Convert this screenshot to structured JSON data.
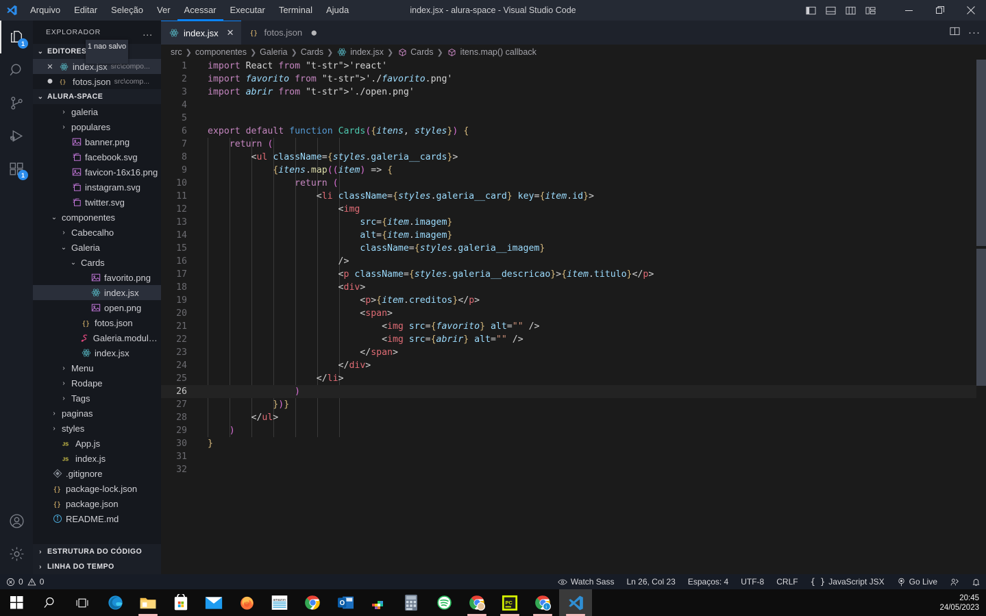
{
  "titlebar": {
    "menus": [
      "Arquivo",
      "Editar",
      "Seleção",
      "Ver",
      "Acessar",
      "Executar",
      "Terminal",
      "Ajuda"
    ],
    "active_menu": "Acessar",
    "window_title": "index.jsx - alura-space - Visual Studio Code",
    "layout_icons": [
      "toggle-primary-sidebar-icon",
      "toggle-panel-icon",
      "toggle-secondary-sidebar-icon",
      "customize-layout-icon"
    ],
    "window_controls": [
      "minimize",
      "restore",
      "close"
    ]
  },
  "activitybar": {
    "items": [
      {
        "name": "explorer-icon",
        "badge": "1",
        "active": true
      },
      {
        "name": "search-icon",
        "badge": "",
        "active": false
      },
      {
        "name": "source-control-icon",
        "badge": "",
        "active": false
      },
      {
        "name": "run-and-debug-icon",
        "badge": "",
        "active": false
      },
      {
        "name": "extensions-icon",
        "badge": "1",
        "active": false
      }
    ],
    "bottom": [
      {
        "name": "accounts-icon"
      },
      {
        "name": "settings-gear-icon"
      }
    ]
  },
  "sidebar": {
    "title": "EXPLORADOR",
    "more_actions": "...",
    "open_editors": {
      "label": "EDITORES ABERT...",
      "tooltip": "1 nao salvo",
      "items": [
        {
          "name": "index.jsx",
          "path": "src\\compo...",
          "state": "close",
          "selected": true
        },
        {
          "name": "fotos.json",
          "path": "src\\comp...",
          "state": "dirty",
          "selected": false
        }
      ]
    },
    "project": {
      "label": "ALURA-SPACE",
      "tree": [
        {
          "label": "galeria",
          "icon": "folder-icon",
          "indent": 2,
          "arrow": "right",
          "selected": false
        },
        {
          "label": "populares",
          "icon": "folder-icon",
          "indent": 2,
          "arrow": "right",
          "selected": false
        },
        {
          "label": "banner.png",
          "icon": "image-file-icon",
          "indent": 2,
          "arrow": "",
          "selected": false
        },
        {
          "label": "facebook.svg",
          "icon": "svg-file-icon",
          "indent": 2,
          "arrow": "",
          "selected": false
        },
        {
          "label": "favicon-16x16.png",
          "icon": "image-file-icon",
          "indent": 2,
          "arrow": "",
          "selected": false
        },
        {
          "label": "instagram.svg",
          "icon": "svg-file-icon",
          "indent": 2,
          "arrow": "",
          "selected": false
        },
        {
          "label": "twitter.svg",
          "icon": "svg-file-icon",
          "indent": 2,
          "arrow": "",
          "selected": false
        },
        {
          "label": "componentes",
          "icon": "folder-icon",
          "indent": 1,
          "arrow": "down",
          "selected": false
        },
        {
          "label": "Cabecalho",
          "icon": "folder-icon",
          "indent": 2,
          "arrow": "right",
          "selected": false
        },
        {
          "label": "Galeria",
          "icon": "folder-icon",
          "indent": 2,
          "arrow": "down",
          "selected": false
        },
        {
          "label": "Cards",
          "icon": "folder-icon",
          "indent": 3,
          "arrow": "down",
          "selected": false
        },
        {
          "label": "favorito.png",
          "icon": "image-file-icon",
          "indent": 4,
          "arrow": "",
          "selected": false
        },
        {
          "label": "index.jsx",
          "icon": "react-file-icon",
          "indent": 4,
          "arrow": "",
          "selected": true
        },
        {
          "label": "open.png",
          "icon": "image-file-icon",
          "indent": 4,
          "arrow": "",
          "selected": false
        },
        {
          "label": "fotos.json",
          "icon": "json-file-icon",
          "indent": 3,
          "arrow": "",
          "selected": false
        },
        {
          "label": "Galeria.module.scss",
          "icon": "sass-file-icon",
          "indent": 3,
          "arrow": "",
          "selected": false
        },
        {
          "label": "index.jsx",
          "icon": "react-file-icon",
          "indent": 3,
          "arrow": "",
          "selected": false
        },
        {
          "label": "Menu",
          "icon": "folder-icon",
          "indent": 2,
          "arrow": "right",
          "selected": false
        },
        {
          "label": "Rodape",
          "icon": "folder-icon",
          "indent": 2,
          "arrow": "right",
          "selected": false
        },
        {
          "label": "Tags",
          "icon": "folder-icon",
          "indent": 2,
          "arrow": "right",
          "selected": false
        },
        {
          "label": "paginas",
          "icon": "folder-icon",
          "indent": 1,
          "arrow": "right",
          "selected": false
        },
        {
          "label": "styles",
          "icon": "folder-icon",
          "indent": 1,
          "arrow": "right",
          "selected": false
        },
        {
          "label": "App.js",
          "icon": "js-file-icon",
          "indent": 1,
          "arrow": "",
          "selected": false
        },
        {
          "label": "index.js",
          "icon": "js-file-icon",
          "indent": 1,
          "arrow": "",
          "selected": false
        },
        {
          "label": ".gitignore",
          "icon": "git-file-icon",
          "indent": 0,
          "arrow": "",
          "selected": false
        },
        {
          "label": "package-lock.json",
          "icon": "json-file-icon",
          "indent": 0,
          "arrow": "",
          "selected": false
        },
        {
          "label": "package.json",
          "icon": "json-file-icon",
          "indent": 0,
          "arrow": "",
          "selected": false
        },
        {
          "label": "README.md",
          "icon": "info-file-icon",
          "indent": 0,
          "arrow": "",
          "selected": false
        }
      ]
    },
    "collapsed_sections": [
      "ESTRUTURA DO CÓDIGO",
      "LINHA DO TEMPO"
    ]
  },
  "editor": {
    "tabs": [
      {
        "label": "index.jsx",
        "icon": "react-file-icon",
        "active": true,
        "dirty": false
      },
      {
        "label": "fotos.json",
        "icon": "json-file-icon",
        "active": false,
        "dirty": true
      }
    ],
    "tab_actions": [
      "split-editor-icon",
      "more-actions-icon"
    ],
    "breadcrumbs": [
      {
        "label": "src",
        "icon": ""
      },
      {
        "label": "componentes",
        "icon": ""
      },
      {
        "label": "Galeria",
        "icon": ""
      },
      {
        "label": "Cards",
        "icon": ""
      },
      {
        "label": "index.jsx",
        "icon": "react-file-icon"
      },
      {
        "label": "Cards",
        "icon": "symbol-class-icon"
      },
      {
        "label": "itens.map() callback",
        "icon": "symbol-class-icon"
      }
    ],
    "current_line": 26,
    "total_lines": 32,
    "lines": [
      "import React from 'react'",
      "import favorito from './favorito.png'",
      "import abrir from './open.png'",
      "",
      "",
      "export default function Cards({itens, styles}) {",
      "    return (",
      "        <ul className={styles.galeria__cards}>",
      "            {itens.map((item) => {",
      "                return (",
      "                    <li className={styles.galeria__card} key={item.id}>",
      "                        <img",
      "                            src={item.imagem}",
      "                            alt={item.imagem}",
      "                            className={styles.galeria__imagem}",
      "                        />",
      "                        <p className={styles.galeria__descricao}>{item.titulo}</p>",
      "                        <div>",
      "                            <p>{item.creditos}</p>",
      "                            <span>",
      "                                <img src={favorito} alt=\"\" />",
      "                                <img src={abrir} alt=\"\" />",
      "                            </span>",
      "                        </div>",
      "                    </li>",
      "                )",
      "            })}",
      "        </ul>",
      "    )",
      "}",
      "",
      ""
    ]
  },
  "statusbar": {
    "errors": "0",
    "warnings": "0",
    "watch_sass": "Watch Sass",
    "cursor": "Ln 26, Col 23",
    "indent": "Espaços: 4",
    "encoding": "UTF-8",
    "eol": "CRLF",
    "language": "JavaScript JSX",
    "go_live": "Go Live",
    "remote_icon": "remote-window-icon",
    "bell_icon": "notifications-bell-icon"
  },
  "taskbar": {
    "items": [
      {
        "name": "start-button-icon",
        "running": false
      },
      {
        "name": "search-taskbar-icon",
        "running": false
      },
      {
        "name": "task-view-icon",
        "running": false
      },
      {
        "name": "microsoft-edge-icon",
        "running": false
      },
      {
        "name": "file-explorer-icon",
        "running": true
      },
      {
        "name": "microsoft-store-icon",
        "running": false
      },
      {
        "name": "mail-icon",
        "running": false
      },
      {
        "name": "firefox-icon",
        "running": false
      },
      {
        "name": "amazon-icon",
        "running": false
      },
      {
        "name": "google-chrome-icon",
        "running": false
      },
      {
        "name": "outlook-icon",
        "running": false
      },
      {
        "name": "tetris-icon",
        "running": false
      },
      {
        "name": "calculator-icon",
        "running": false
      },
      {
        "name": "spotify-icon",
        "running": false
      },
      {
        "name": "chrome-profile-icon",
        "running": true
      },
      {
        "name": "pycharm-icon",
        "running": true
      },
      {
        "name": "chrome-beta-icon",
        "running": true
      },
      {
        "name": "visual-studio-code-icon",
        "running": true
      }
    ],
    "clock_time": "20:45",
    "clock_date": "24/05/2023"
  },
  "colors": {
    "accent": "#0a84ff",
    "titlebar_bg": "#252a34",
    "sidebar_bg": "#15181e",
    "editor_bg": "#1b1b1b",
    "statusbar_bg": "#171c26",
    "badge": "#2b8ceb"
  }
}
